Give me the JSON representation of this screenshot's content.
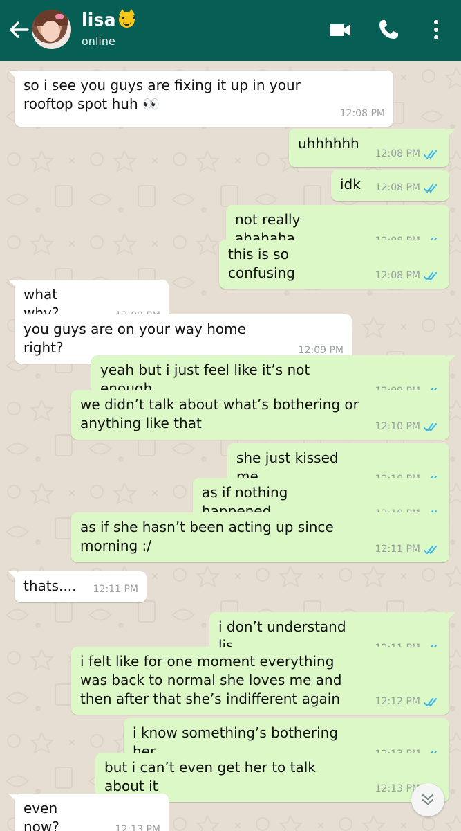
{
  "header": {
    "contact_name": "lisa",
    "contact_emoji": "cat-face-emoji",
    "status": "online",
    "colors": {
      "bar": "#075e54",
      "outgoing_bubble": "#dcf8c6",
      "incoming_bubble": "#ffffff",
      "read_ticks": "#34b7f1"
    }
  },
  "messages": [
    {
      "direction": "in",
      "text": "so i see you guys are fixing it up in your rooftop spot huh 👀",
      "time": "12:08 PM"
    },
    {
      "direction": "out",
      "text": "uhhhhhh",
      "time": "12:08 PM",
      "read": true
    },
    {
      "direction": "out",
      "text": "idk",
      "time": "12:08 PM",
      "read": true
    },
    {
      "direction": "out",
      "text": "not really ahahaha",
      "time": "12:08 PM",
      "read": true
    },
    {
      "direction": "out",
      "text": "this is so confusing",
      "time": "12:08 PM",
      "read": true
    },
    {
      "direction": "in",
      "text": "what why?",
      "time": "12:09 PM"
    },
    {
      "direction": "in",
      "text": "you guys are on your way home right?",
      "time": "12:09 PM"
    },
    {
      "direction": "out",
      "text": "yeah but i just feel like it’s not enough",
      "time": "12:09 PM",
      "read": true
    },
    {
      "direction": "out",
      "text": "we didn’t talk about what’s bothering or anything like that",
      "time": "12:10 PM",
      "read": true
    },
    {
      "direction": "out",
      "text": "she just kissed me",
      "time": "12:10 PM",
      "read": true
    },
    {
      "direction": "out",
      "text": "as if nothing happened",
      "time": "12:10 PM",
      "read": true
    },
    {
      "direction": "out",
      "text": "as if she hasn’t been acting up since morning :/",
      "time": "12:11 PM",
      "read": true
    },
    {
      "direction": "in",
      "text": "thats....",
      "time": "12:11 PM"
    },
    {
      "direction": "out",
      "text": "i don’t understand lis",
      "time": "12:11 PM",
      "read": true
    },
    {
      "direction": "out",
      "text": "i felt like for one moment everything was back to normal she loves me and then after that she’s indifferent again",
      "time": "12:12 PM",
      "read": true
    },
    {
      "direction": "out",
      "text": "i know something’s bothering her",
      "time": "12:13 PM",
      "read": true
    },
    {
      "direction": "out",
      "text": "but i can’t even get her to talk about it",
      "time": "12:13 PM",
      "read": true
    },
    {
      "direction": "in",
      "text": "even now?",
      "time": "12:13 PM"
    }
  ]
}
